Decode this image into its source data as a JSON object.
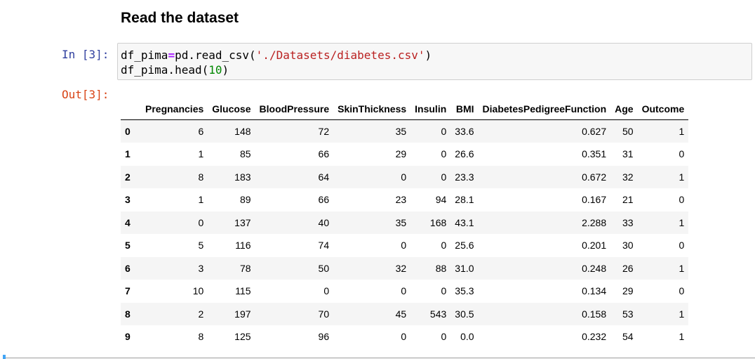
{
  "heading": "Read the dataset",
  "input_prompt": "In [3]:",
  "output_prompt": "Out[3]:",
  "code": {
    "line1": {
      "a": "df_pima",
      "op": "=",
      "b": "pd.read_csv(",
      "str": "'./Datasets/diabetes.csv'",
      "c": ")"
    },
    "line2": {
      "a": "df_pima.head(",
      "num": "10",
      "b": ")"
    }
  },
  "table": {
    "columns": [
      "",
      "Pregnancies",
      "Glucose",
      "BloodPressure",
      "SkinThickness",
      "Insulin",
      "BMI",
      "DiabetesPedigreeFunction",
      "Age",
      "Outcome"
    ],
    "rows": [
      [
        "0",
        "6",
        "148",
        "72",
        "35",
        "0",
        "33.6",
        "0.627",
        "50",
        "1"
      ],
      [
        "1",
        "1",
        "85",
        "66",
        "29",
        "0",
        "26.6",
        "0.351",
        "31",
        "0"
      ],
      [
        "2",
        "8",
        "183",
        "64",
        "0",
        "0",
        "23.3",
        "0.672",
        "32",
        "1"
      ],
      [
        "3",
        "1",
        "89",
        "66",
        "23",
        "94",
        "28.1",
        "0.167",
        "21",
        "0"
      ],
      [
        "4",
        "0",
        "137",
        "40",
        "35",
        "168",
        "43.1",
        "2.288",
        "33",
        "1"
      ],
      [
        "5",
        "5",
        "116",
        "74",
        "0",
        "0",
        "25.6",
        "0.201",
        "30",
        "0"
      ],
      [
        "6",
        "3",
        "78",
        "50",
        "32",
        "88",
        "31.0",
        "0.248",
        "26",
        "1"
      ],
      [
        "7",
        "10",
        "115",
        "0",
        "0",
        "0",
        "35.3",
        "0.134",
        "29",
        "0"
      ],
      [
        "8",
        "2",
        "197",
        "70",
        "45",
        "543",
        "30.5",
        "0.158",
        "53",
        "1"
      ],
      [
        "9",
        "8",
        "125",
        "96",
        "0",
        "0",
        "0.0",
        "0.232",
        "54",
        "1"
      ]
    ]
  },
  "colors": {
    "in_prompt": "#303f9f",
    "out_prompt": "#d84315",
    "operator": "#aa22ff",
    "string": "#ba2121",
    "number": "#008800",
    "cell_bg": "#f7f7f7",
    "stripe": "#f5f5f5"
  }
}
